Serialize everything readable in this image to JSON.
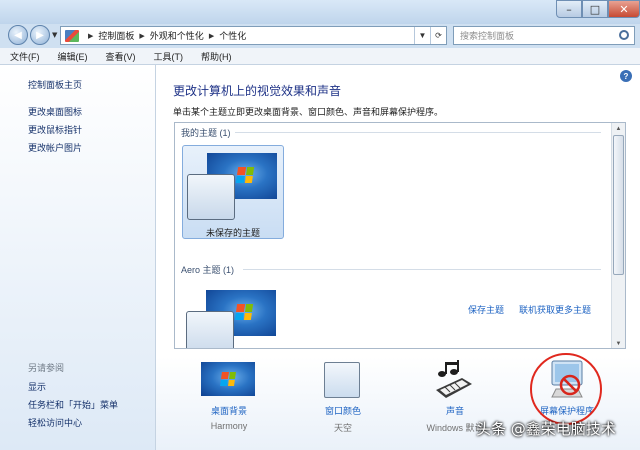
{
  "window": {
    "minimize_glyph": "–",
    "maximize_glyph": "□",
    "close_glyph": "✕"
  },
  "nav": {
    "back_glyph": "◀",
    "forward_glyph": "▶",
    "breadcrumbs": [
      "控制面板",
      "外观和个性化",
      "个性化"
    ],
    "search_placeholder": "搜索控制面板"
  },
  "menu": {
    "items": [
      "文件(F)",
      "编辑(E)",
      "查看(V)",
      "工具(T)",
      "帮助(H)"
    ]
  },
  "sidebar": {
    "home": "控制面板主页",
    "links": [
      "更改桌面图标",
      "更改鼠标指针",
      "更改帐户图片"
    ],
    "see_also_title": "另请参阅",
    "see_also": [
      "显示",
      "任务栏和「开始」菜单",
      "轻松访问中心"
    ]
  },
  "main": {
    "title": "更改计算机上的视觉效果和声音",
    "subtitle": "单击某个主题立即更改桌面背景、窗口颜色、声音和屏幕保护程序。",
    "my_themes_header": "我的主题 (1)",
    "unsaved_theme_label": "未保存的主题",
    "save_theme": "保存主题",
    "get_more_themes": "联机获取更多主题",
    "aero_header": "Aero 主题 (1)"
  },
  "bottom": {
    "items": [
      {
        "label": "桌面背景",
        "sub": "Harmony"
      },
      {
        "label": "窗口颜色",
        "sub": "天空"
      },
      {
        "label": "声音",
        "sub": "Windows 默认"
      },
      {
        "label": "屏幕保护程序",
        "sub": ""
      }
    ]
  },
  "watermark": "头条 @鑫荣电脑技术",
  "colors": {
    "link": "#1f64c3",
    "heading": "#1e3287",
    "highlight_circle": "#e0281e"
  }
}
